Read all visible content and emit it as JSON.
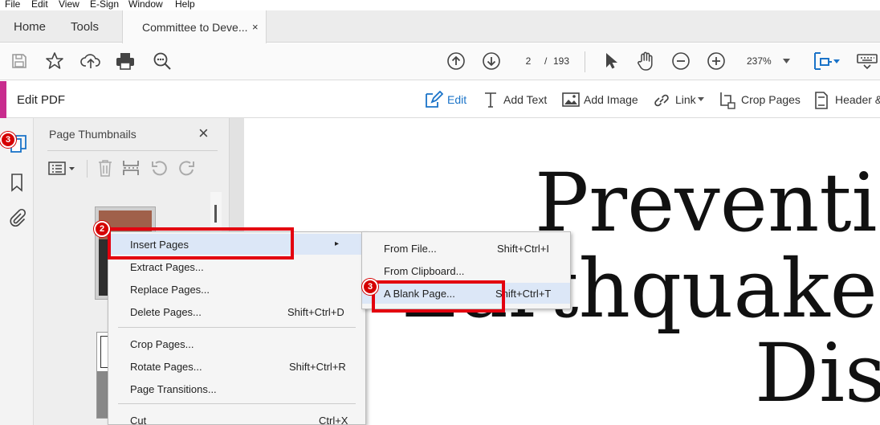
{
  "menubar": {
    "file": "File",
    "edit": "Edit",
    "view": "View",
    "esign": "E-Sign",
    "window": "Window",
    "help": "Help"
  },
  "tabs": {
    "home": "Home",
    "tools": "Tools",
    "document": "Committee to Deve...",
    "close": "×"
  },
  "toolbar": {
    "page_current": "2",
    "page_sep": "/",
    "page_total": "193",
    "zoom": "237%"
  },
  "editbar": {
    "title": "Edit PDF",
    "edit": "Edit",
    "add_text": "Add Text",
    "add_image": "Add Image",
    "link": "Link",
    "crop_pages": "Crop Pages",
    "header_footer": "Header &"
  },
  "panel": {
    "title": "Page Thumbnails",
    "close": "×"
  },
  "document": {
    "line1": "Preventir",
    "line2": "Earthquake",
    "line3": "Disa"
  },
  "context_menu": {
    "items": [
      {
        "label": "Insert Pages",
        "shortcut": "",
        "submenu": "▸"
      },
      {
        "label": "Extract Pages...",
        "shortcut": ""
      },
      {
        "label": "Replace Pages...",
        "shortcut": ""
      },
      {
        "label": "Delete Pages...",
        "shortcut": "Shift+Ctrl+D"
      },
      {
        "label": "Crop Pages...",
        "shortcut": ""
      },
      {
        "label": "Rotate Pages...",
        "shortcut": "Shift+Ctrl+R"
      },
      {
        "label": "Page Transitions...",
        "shortcut": ""
      },
      {
        "label": "Cut",
        "shortcut": "Ctrl+X"
      }
    ]
  },
  "submenu": {
    "items": [
      {
        "label": "From File...",
        "shortcut": "Shift+Ctrl+I"
      },
      {
        "label": "From Clipboard...",
        "shortcut": ""
      },
      {
        "label": "A Blank Page...",
        "shortcut": "Shift+Ctrl+T"
      }
    ]
  },
  "annotations": {
    "badge_rail": "3",
    "badge_insert": "2",
    "badge_blank": "3",
    "highlight_color": "#e3000f"
  },
  "colors": {
    "accent": "#c82c8e",
    "icon_blue": "#1a73c8",
    "menu_hover": "#dce7f7"
  }
}
